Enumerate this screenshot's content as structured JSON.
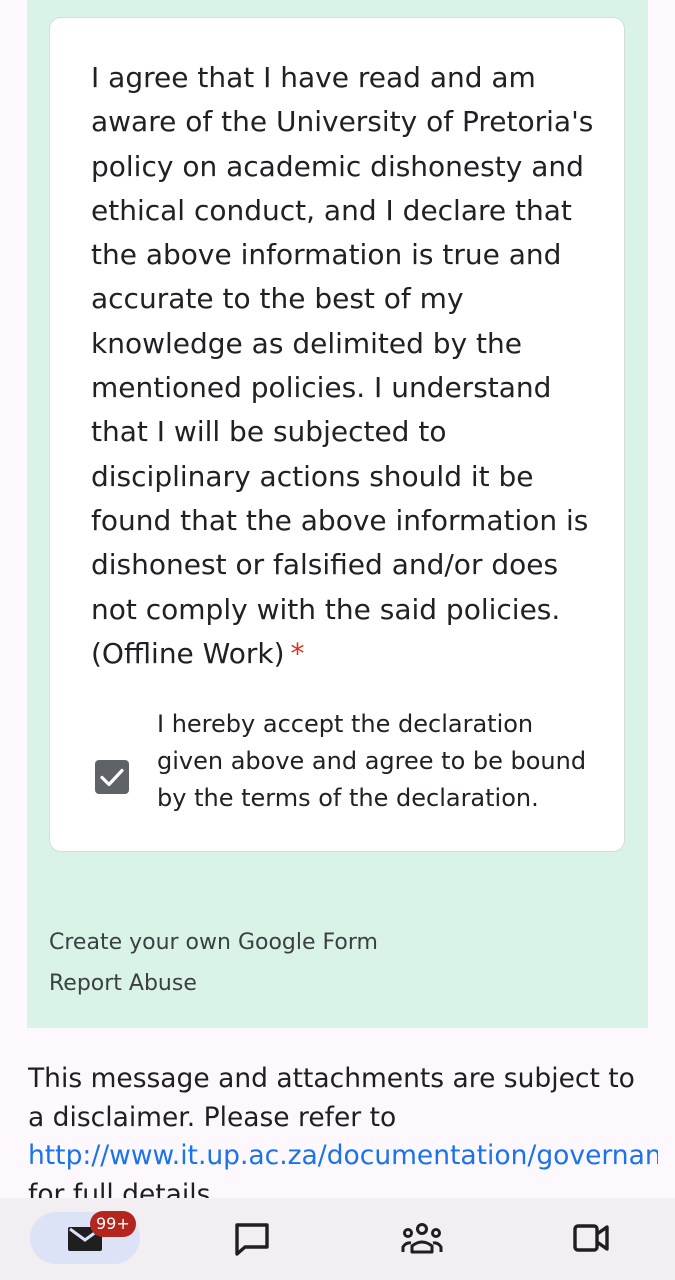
{
  "form": {
    "question": "I agree that I have read and am aware of the University of Pretoria's policy on academic dishonesty and ethical conduct, and I declare that the above information is true and accurate to the best of my knowledge as delimited by the mentioned policies. I understand that I will be subjected to disciplinary actions should it be found that the above information is dishonest or falsified and/or does not comply with the said policies. (Offline Work)",
    "required_marker": "*",
    "checkbox_label": "I hereby accept the declaration given above and agree to be bound by the terms of the declaration.",
    "checkbox_checked": true,
    "create_link": "Create your own Google Form",
    "report_link": "Report Abuse"
  },
  "email": {
    "disclaimer_text": "This message and attachments are subject to a disclaimer. Please refer to",
    "disclaimer_url": "http://www.it.up.ac.za/documentation/governance/disclaimer/",
    "disclaimer_tail": "for full details."
  },
  "nav": {
    "mail_badge": "99+",
    "items": [
      "mail-icon",
      "chat-icon",
      "spaces-icon",
      "meet-icon"
    ]
  },
  "colors": {
    "form_bg": "#d9f4e7",
    "required": "#d93025",
    "link": "#1a73e8",
    "badge": "#b3261e"
  }
}
